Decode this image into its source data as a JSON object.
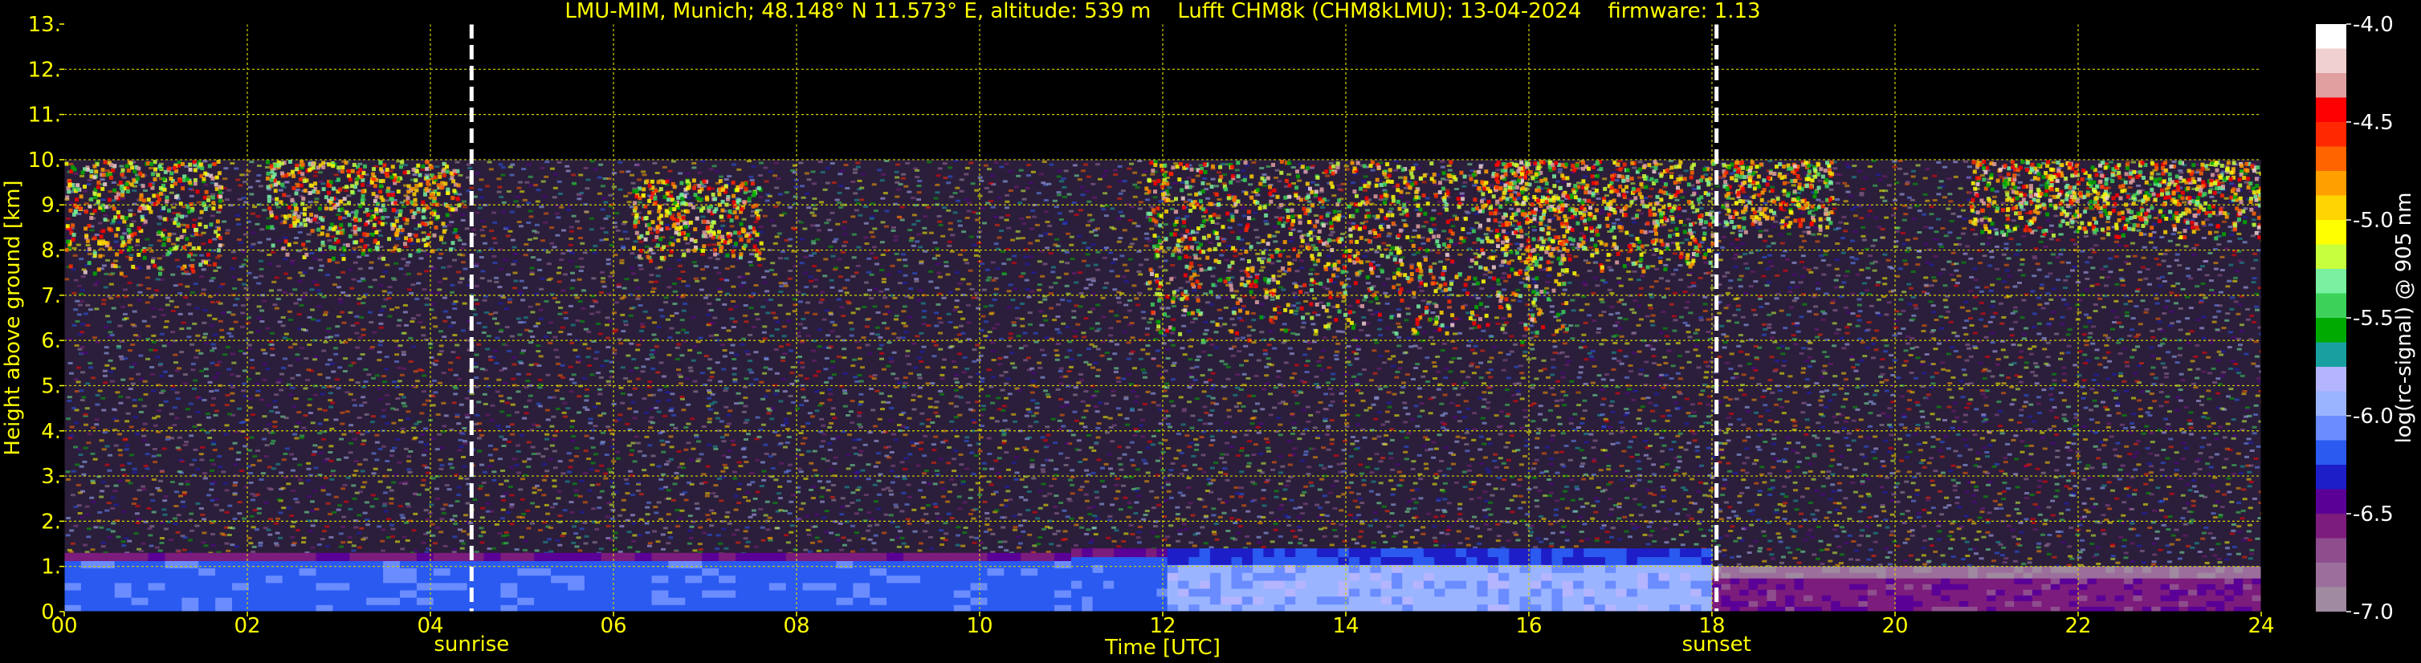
{
  "chart_data": {
    "type": "heatmap",
    "title": "LMU-MIM, Munich; 48.148° N 11.573° E, altitude: 539 m    Lufft CHM8k (CHM8kLMU): 13-04-2024    firmware: 1.13",
    "xlabel": "Time [UTC]",
    "ylabel": "Height above ground [km]",
    "xlim": [
      0,
      24
    ],
    "ylim": [
      0,
      13
    ],
    "x_ticks": [
      "00",
      "02",
      "04",
      "06",
      "08",
      "10",
      "12",
      "14",
      "16",
      "18",
      "20",
      "22",
      "24"
    ],
    "y_ticks": [
      "0.",
      "1.",
      "2.",
      "3.",
      "4.",
      "5.",
      "6.",
      "7.",
      "8.",
      "9.",
      "10.",
      "11.",
      "12.",
      "13."
    ],
    "grid": true,
    "events": [
      {
        "label": "sunrise",
        "time": 4.45
      },
      {
        "label": "sunset",
        "time": 18.05
      }
    ],
    "colorbar": {
      "label": "log(rc-signal) @ 905 nm",
      "ticks": [
        "-4.0",
        "-4.5",
        "-5.0",
        "-5.5",
        "-6.0",
        "-6.5",
        "-7.0"
      ],
      "range": [
        -7.0,
        -4.0
      ],
      "colors": [
        "#a08aa0",
        "#9c6e9c",
        "#8e4e8e",
        "#7c1c7c",
        "#5a0096",
        "#1e1ec8",
        "#2a5af0",
        "#6a8cff",
        "#9ab4ff",
        "#b4b4ff",
        "#18a0a0",
        "#00aa00",
        "#3cd25a",
        "#78f0a0",
        "#c8ff3c",
        "#ffff00",
        "#ffd400",
        "#ffa000",
        "#ff6400",
        "#ff2800",
        "#ff0000",
        "#e0a0a0",
        "#f0d0d0",
        "#ffffff"
      ]
    },
    "data_range_top_km": 10,
    "features": [
      {
        "type": "cirrus",
        "t0": 0.0,
        "t1": 1.7,
        "h0": 7.5,
        "h1": 10.0
      },
      {
        "type": "cirrus",
        "t0": 2.2,
        "t1": 4.3,
        "h0": 7.8,
        "h1": 10.0
      },
      {
        "type": "cirrus",
        "t0": 6.2,
        "t1": 7.6,
        "h0": 7.8,
        "h1": 9.6
      },
      {
        "type": "cirrus",
        "t0": 11.8,
        "t1": 16.4,
        "h0": 6.0,
        "h1": 10.0
      },
      {
        "type": "cirrus",
        "t0": 15.6,
        "t1": 18.0,
        "h0": 7.5,
        "h1": 10.0
      },
      {
        "type": "cirrus",
        "t0": 18.1,
        "t1": 19.3,
        "h0": 8.3,
        "h1": 10.0
      },
      {
        "type": "cirrus",
        "t0": 20.8,
        "t1": 24.0,
        "h0": 8.3,
        "h1": 10.0
      },
      {
        "type": "boundary_layer",
        "t0": 0.0,
        "t1": 11.0,
        "h0": 0.0,
        "h1": 1.3
      },
      {
        "type": "boundary_layer",
        "t0": 11.0,
        "t1": 18.0,
        "h0": 0.0,
        "h1": 1.4
      },
      {
        "type": "boundary_layer",
        "t0": 18.0,
        "t1": 24.0,
        "h0": 0.0,
        "h1": 1.0
      }
    ]
  }
}
